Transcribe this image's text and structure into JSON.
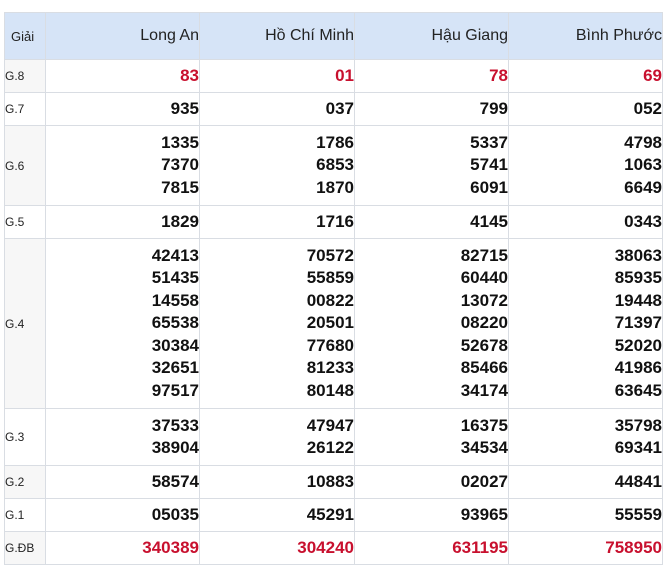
{
  "table": {
    "header": {
      "prize": "Giải",
      "provinces": [
        "Long An",
        "Hồ Chí Minh",
        "Hậu Giang",
        "Bình Phước"
      ]
    },
    "rows": [
      {
        "prize": "G.8",
        "highlight": true,
        "values": [
          [
            "83"
          ],
          [
            "01"
          ],
          [
            "78"
          ],
          [
            "69"
          ]
        ]
      },
      {
        "prize": "G.7",
        "highlight": false,
        "values": [
          [
            "935"
          ],
          [
            "037"
          ],
          [
            "799"
          ],
          [
            "052"
          ]
        ]
      },
      {
        "prize": "G.6",
        "highlight": false,
        "values": [
          [
            "1335",
            "7370",
            "7815"
          ],
          [
            "1786",
            "6853",
            "1870"
          ],
          [
            "5337",
            "5741",
            "6091"
          ],
          [
            "4798",
            "1063",
            "6649"
          ]
        ]
      },
      {
        "prize": "G.5",
        "highlight": false,
        "values": [
          [
            "1829"
          ],
          [
            "1716"
          ],
          [
            "4145"
          ],
          [
            "0343"
          ]
        ]
      },
      {
        "prize": "G.4",
        "highlight": false,
        "values": [
          [
            "42413",
            "51435",
            "14558",
            "65538",
            "30384",
            "32651",
            "97517"
          ],
          [
            "70572",
            "55859",
            "00822",
            "20501",
            "77680",
            "81233",
            "80148"
          ],
          [
            "82715",
            "60440",
            "13072",
            "08220",
            "52678",
            "85466",
            "34174"
          ],
          [
            "38063",
            "85935",
            "19448",
            "71397",
            "52020",
            "41986",
            "63645"
          ]
        ]
      },
      {
        "prize": "G.3",
        "highlight": false,
        "values": [
          [
            "37533",
            "38904"
          ],
          [
            "47947",
            "26122"
          ],
          [
            "16375",
            "34534"
          ],
          [
            "35798",
            "69341"
          ]
        ]
      },
      {
        "prize": "G.2",
        "highlight": false,
        "values": [
          [
            "58574"
          ],
          [
            "10883"
          ],
          [
            "02027"
          ],
          [
            "44841"
          ]
        ]
      },
      {
        "prize": "G.1",
        "highlight": false,
        "values": [
          [
            "05035"
          ],
          [
            "45291"
          ],
          [
            "93965"
          ],
          [
            "55559"
          ]
        ]
      },
      {
        "prize": "G.ĐB",
        "highlight": true,
        "values": [
          [
            "340389"
          ],
          [
            "304240"
          ],
          [
            "631195"
          ],
          [
            "758950"
          ]
        ]
      }
    ],
    "colors": {
      "header_bg": "#d6e4f7",
      "highlight": "#c8102e",
      "border": "#d9dde3"
    }
  }
}
